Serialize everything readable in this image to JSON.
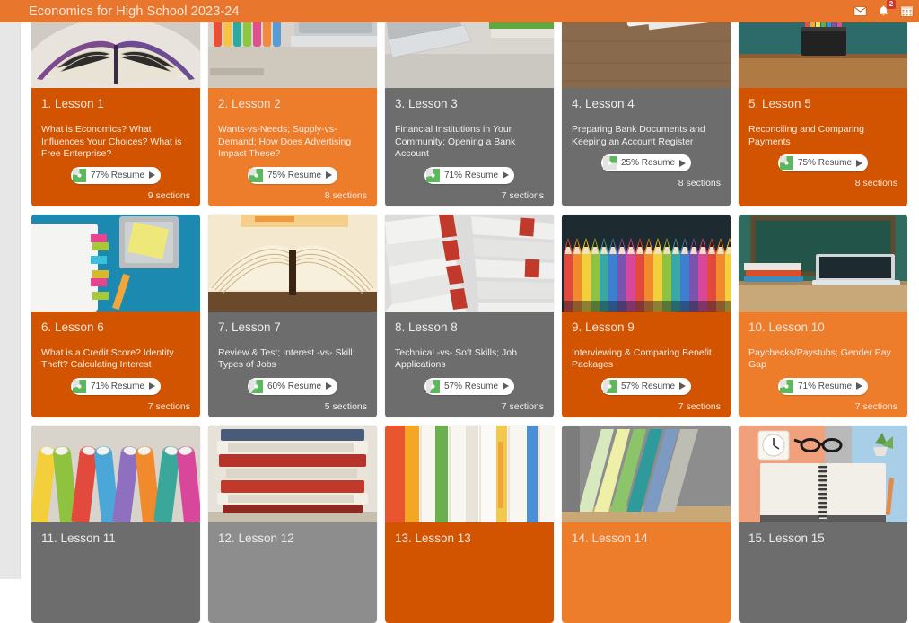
{
  "topbar": {
    "title": "Economics for High School 2023-24",
    "icons": [
      {
        "name": "mail-icon",
        "glyph": "envelope"
      },
      {
        "name": "notifications-bell-icon",
        "glyph": "bell",
        "badge": "2"
      },
      {
        "name": "calendar-icon",
        "glyph": "calendar"
      }
    ],
    "bell_badge": "2",
    "accent_color": "#e8762c"
  },
  "colors": {
    "accent_orange": "#e8762c",
    "card_orange_dark": "#d35400",
    "card_orange_light": "#ed7d2b",
    "card_grey_dark": "#6d6d6d",
    "card_grey_light": "#8d8d8d",
    "progress_green": "#5cb85c",
    "badge_red": "#d0342c"
  },
  "pill": {
    "resume_label": "Resume",
    "play_icon": "play-icon"
  },
  "cards": [
    {
      "number": "1.",
      "title": "1. Lesson 1",
      "desc": "What is Economics? What Influences Your Choices? What is Free Enterprise?",
      "percent": "77%",
      "percent_value": 77,
      "pill_text": "77% Resume",
      "sections": "9 sections",
      "color": "orange",
      "thumb": "open-book-purple"
    },
    {
      "number": "2.",
      "title": "2. Lesson 2",
      "desc": "Wants-vs-Needs; Supply-vs-Demand; How Does Advertising Impact These?",
      "percent": "75%",
      "percent_value": 75,
      "pill_text": "75% Resume",
      "sections": "8 sections",
      "color": "orange-light",
      "thumb": "desk-supplies-laptop"
    },
    {
      "number": "3.",
      "title": "3. Lesson 3",
      "desc": "Financial Institutions in Your Community; Opening a Bank Account",
      "percent": "71%",
      "percent_value": 71,
      "pill_text": "71% Resume",
      "sections": "7 sections",
      "color": "grey",
      "thumb": "laptop-books-orange"
    },
    {
      "number": "4.",
      "title": "4. Lesson 4",
      "desc": "Preparing Bank Documents and Keeping an Account Register",
      "percent": "25%",
      "percent_value": 25,
      "pill_text": "25% Resume",
      "sections": "8 sections",
      "color": "grey",
      "thumb": "notebook-wood-desk"
    },
    {
      "number": "5.",
      "title": "5. Lesson 5",
      "desc": "Reconciling and Comparing Payments",
      "percent": "75%",
      "percent_value": 75,
      "pill_text": "75% Resume",
      "sections": "8 sections",
      "color": "orange",
      "thumb": "pen-cup-teal-wall"
    },
    {
      "number": "6.",
      "title": "6. Lesson 6",
      "desc": "What is a Credit Score? Identity Theft? Calculating Interest",
      "percent": "71%",
      "percent_value": 71,
      "pill_text": "71% Resume",
      "sections": "7 sections",
      "color": "orange",
      "thumb": "notebook-sticky-notes-teal"
    },
    {
      "number": "7.",
      "title": "7. Lesson 7",
      "desc": "Review & Test; Interest -vs- Skill; Types of Jobs",
      "percent": "60%",
      "percent_value": 60,
      "pill_text": "60% Resume",
      "sections": "5 sections",
      "color": "grey",
      "thumb": "open-book-pages"
    },
    {
      "number": "8.",
      "title": "8. Lesson 8",
      "desc": "Technical -vs- Soft Skills; Job Applications",
      "percent": "57%",
      "percent_value": 57,
      "pill_text": "57% Resume",
      "sections": "7 sections",
      "color": "grey",
      "thumb": "stacked-book-edges"
    },
    {
      "number": "9.",
      "title": "9. Lesson 9",
      "desc": "Interviewing & Comparing Benefit Packages",
      "percent": "57%",
      "percent_value": 57,
      "pill_text": "57% Resume",
      "sections": "7 sections",
      "color": "orange",
      "thumb": "colored-pencil-tips"
    },
    {
      "number": "10.",
      "title": "10. Lesson 10",
      "desc": "Paychecks/Paystubs; Gender Pay Gap",
      "percent": "71%",
      "percent_value": 71,
      "pill_text": "71% Resume",
      "sections": "7 sections",
      "color": "orange-light",
      "thumb": "laptop-books-chalkboard"
    },
    {
      "number": "11.",
      "title": "11. Lesson 11",
      "desc": "",
      "percent": "",
      "percent_value": 0,
      "pill_text": "",
      "sections": "",
      "color": "grey",
      "thumb": "colored-pencils-tops"
    },
    {
      "number": "12.",
      "title": "12. Lesson 12",
      "desc": "",
      "percent": "",
      "percent_value": 0,
      "pill_text": "",
      "sections": "",
      "color": "grey-light",
      "thumb": "stacked-red-books"
    },
    {
      "number": "13.",
      "title": "13. Lesson 13",
      "desc": "",
      "percent": "",
      "percent_value": 0,
      "pill_text": "",
      "sections": "",
      "color": "orange",
      "thumb": "colorful-notebook-spines"
    },
    {
      "number": "14.",
      "title": "14. Lesson 14",
      "desc": "",
      "percent": "",
      "percent_value": 0,
      "pill_text": "",
      "sections": "",
      "color": "orange-light",
      "thumb": "pastel-rolled-papers"
    },
    {
      "number": "15.",
      "title": "15. Lesson 15",
      "desc": "",
      "percent": "",
      "percent_value": 0,
      "pill_text": "",
      "sections": "",
      "color": "grey",
      "thumb": "desk-clock-glasses-notebook"
    }
  ]
}
